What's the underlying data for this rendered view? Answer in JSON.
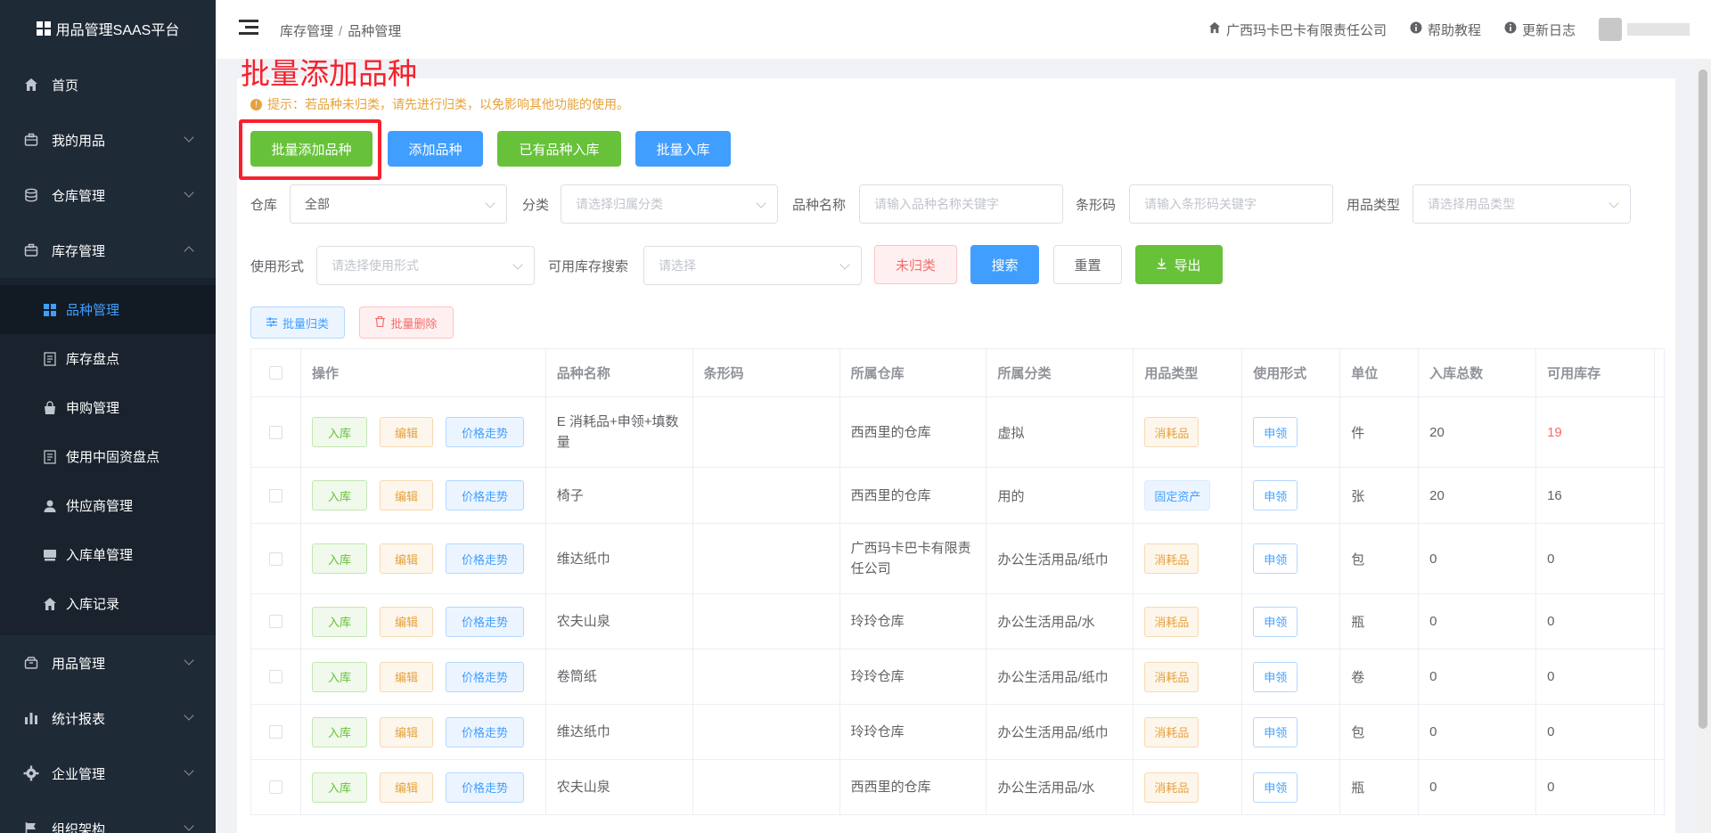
{
  "app": {
    "title": "用品管理SAAS平台"
  },
  "sidebar": {
    "items": [
      {
        "label": "首页",
        "icon": "home-icon"
      },
      {
        "label": "我的用品",
        "icon": "briefcase-icon"
      },
      {
        "label": "仓库管理",
        "icon": "database-icon"
      },
      {
        "label": "库存管理",
        "icon": "briefcase-icon"
      },
      {
        "label": "用品管理",
        "icon": "box-icon"
      },
      {
        "label": "统计报表",
        "icon": "bar-chart-icon"
      },
      {
        "label": "企业管理",
        "icon": "gear-icon"
      },
      {
        "label": "组织架构",
        "icon": "flag-icon"
      }
    ],
    "sub_items": [
      {
        "label": "品种管理",
        "icon": "grid-icon"
      },
      {
        "label": "库存盘点",
        "icon": "document-icon"
      },
      {
        "label": "申购管理",
        "icon": "bag-icon"
      },
      {
        "label": "使用中固资盘点",
        "icon": "document-icon"
      },
      {
        "label": "供应商管理",
        "icon": "user-icon"
      },
      {
        "label": "入库单管理",
        "icon": "stack-icon"
      },
      {
        "label": "入库记录",
        "icon": "home-icon"
      }
    ]
  },
  "header": {
    "breadcrumb": [
      "库存管理",
      "品种管理"
    ],
    "breadcrumb_sep": "/",
    "company": "广西玛卡巴卡有限责任公司",
    "help": "帮助教程",
    "changelog": "更新日志"
  },
  "page": {
    "annotation": "批量添加品种",
    "tip": "提示：若品种未归类，请先进行归类，以免影响其他功能的使用。",
    "actions": {
      "batch_add": "批量添加品种",
      "add": "添加品种",
      "existing_in": "已有品种入库",
      "batch_in": "批量入库"
    },
    "filters": {
      "warehouse_label": "仓库",
      "warehouse_value": "全部",
      "category_label": "分类",
      "category_placeholder": "请选择归属分类",
      "name_label": "品种名称",
      "name_placeholder": "请输入品种名称关键字",
      "barcode_label": "条形码",
      "barcode_placeholder": "请输入条形码关键字",
      "type_label": "用品类型",
      "type_placeholder": "请选择用品类型",
      "usage_label": "使用形式",
      "usage_placeholder": "请选择使用形式",
      "stock_label": "可用库存搜索",
      "stock_placeholder": "请选择"
    },
    "filter_buttons": {
      "unclassified": "未归类",
      "search": "搜索",
      "reset": "重置",
      "export": "导出"
    },
    "batch_buttons": {
      "classify": "批量归类",
      "delete": "批量删除"
    }
  },
  "table": {
    "headers": [
      "操作",
      "品种名称",
      "条形码",
      "所属仓库",
      "所属分类",
      "用品类型",
      "使用形式",
      "单位",
      "入库总数",
      "可用库存"
    ],
    "row_actions": {
      "in": "入库",
      "edit": "编辑",
      "trend": "价格走势"
    },
    "rows": [
      {
        "name": "E 消耗品+申领+填数量",
        "barcode": "",
        "warehouse": "西西里的仓库",
        "category": "虚拟",
        "type": "消耗品",
        "usage": "申领",
        "unit": "件",
        "total": "20",
        "available": "19"
      },
      {
        "name": "椅子",
        "barcode": "",
        "warehouse": "西西里的仓库",
        "category": "用的",
        "type": "固定资产",
        "usage": "申领",
        "unit": "张",
        "total": "20",
        "available": "16"
      },
      {
        "name": "维达纸巾",
        "barcode": "",
        "warehouse": "广西玛卡巴卡有限责任公司",
        "category": "办公生活用品/纸巾",
        "type": "消耗品",
        "usage": "申领",
        "unit": "包",
        "total": "0",
        "available": "0"
      },
      {
        "name": "农夫山泉",
        "barcode": "",
        "warehouse": "玲玲仓库",
        "category": "办公生活用品/水",
        "type": "消耗品",
        "usage": "申领",
        "unit": "瓶",
        "total": "0",
        "available": "0"
      },
      {
        "name": "卷筒纸",
        "barcode": "",
        "warehouse": "玲玲仓库",
        "category": "办公生活用品/纸巾",
        "type": "消耗品",
        "usage": "申领",
        "unit": "卷",
        "total": "0",
        "available": "0"
      },
      {
        "name": "维达纸巾",
        "barcode": "",
        "warehouse": "玲玲仓库",
        "category": "办公生活用品/纸巾",
        "type": "消耗品",
        "usage": "申领",
        "unit": "包",
        "total": "0",
        "available": "0"
      },
      {
        "name": "农夫山泉",
        "barcode": "",
        "warehouse": "西西里的仓库",
        "category": "办公生活用品/水",
        "type": "消耗品",
        "usage": "申领",
        "unit": "瓶",
        "total": "0",
        "available": "0"
      }
    ]
  },
  "colors": {
    "sidebar_bg": "#1f2a37",
    "accent": "#409eff",
    "success": "#67c23a",
    "warning": "#e6a23c",
    "danger": "#f56c6c",
    "annotation": "#f5222d"
  }
}
